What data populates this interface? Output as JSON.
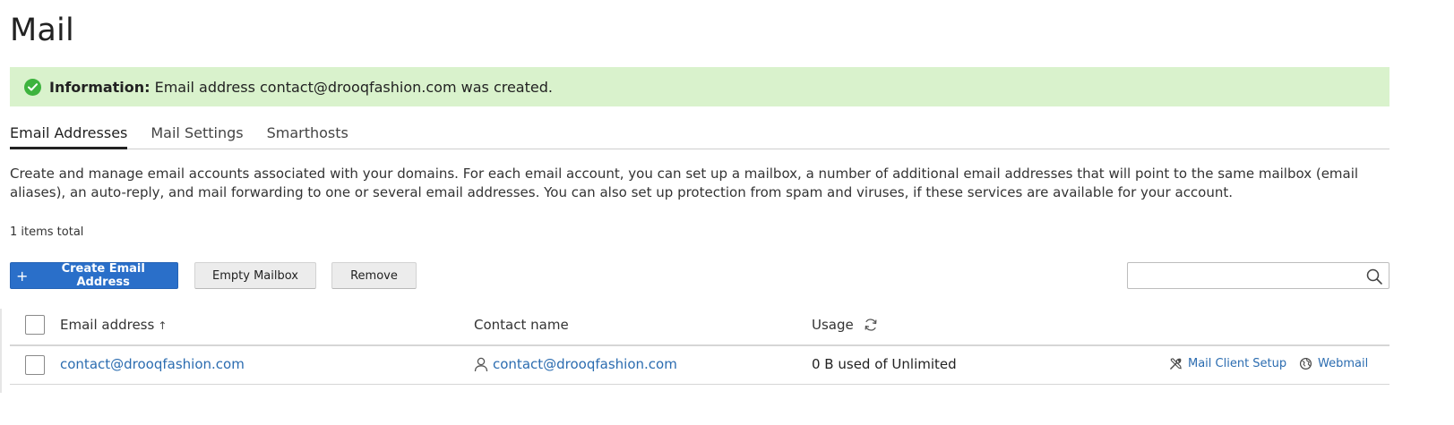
{
  "page": {
    "title": "Mail"
  },
  "message": {
    "label": "Information:",
    "text": "Email address contact@drooqfashion.com was created.",
    "icon": "check-circle-icon",
    "color": "#d9f2cc"
  },
  "tabs": [
    {
      "label": "Email Addresses",
      "active": true
    },
    {
      "label": "Mail Settings",
      "active": false
    },
    {
      "label": "Smarthosts",
      "active": false
    }
  ],
  "description": "Create and manage email accounts associated with your domains. For each email account, you can set up a mailbox, a number of additional email addresses that will point to the same mailbox (email aliases), an auto-reply, and mail forwarding to one or several email addresses. You can also set up protection from spam and viruses, if these services are available for your account.",
  "items_total": "1 items total",
  "toolbar": {
    "create_label": "Create Email Address",
    "create_icon": "plus-icon",
    "empty_label": "Empty Mailbox",
    "remove_label": "Remove",
    "primary_color": "#2a6fc9"
  },
  "search": {
    "placeholder": "",
    "value": "",
    "icon": "search-icon"
  },
  "table": {
    "columns": {
      "email": "Email address",
      "email_sort": "↑",
      "contact": "Contact name",
      "usage": "Usage"
    },
    "rows": [
      {
        "email": "contact@drooqfashion.com",
        "contact": "contact@drooqfashion.com",
        "usage": "0 B used of Unlimited",
        "actions": {
          "setup": "Mail Client Setup",
          "webmail": "Webmail"
        }
      }
    ]
  },
  "link_color": "#2b6cb0"
}
